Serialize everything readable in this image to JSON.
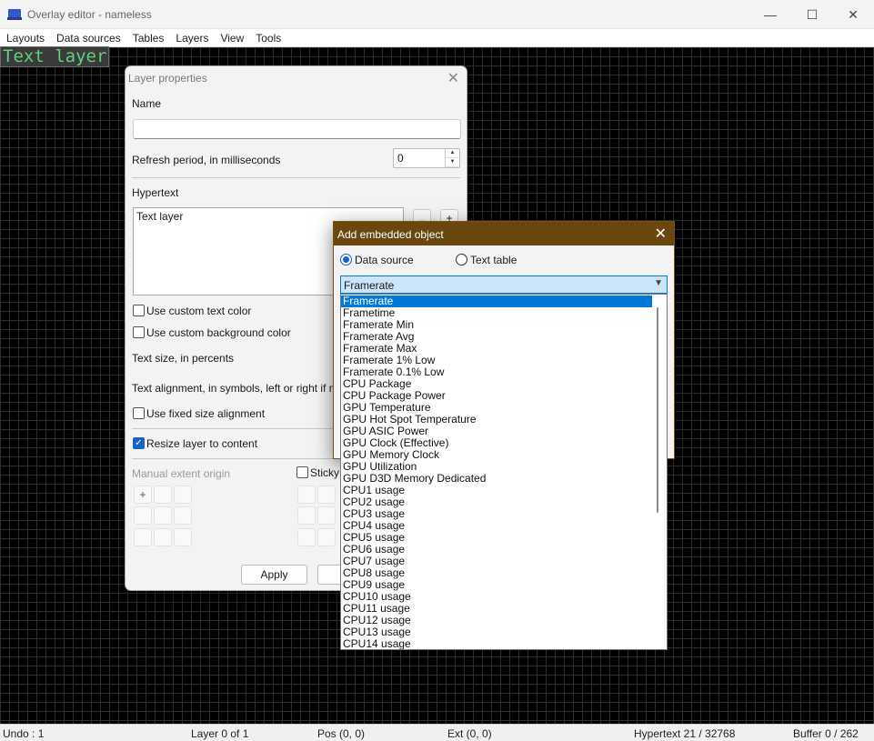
{
  "window": {
    "title": "Overlay editor - nameless",
    "minimize": "—",
    "maximize": "☐",
    "close": "✕"
  },
  "menu": [
    "Layouts",
    "Data sources",
    "Tables",
    "Layers",
    "View",
    "Tools"
  ],
  "canvas": {
    "layer_label": "Text layer"
  },
  "status": {
    "undo": "Undo : 1",
    "layer": "Layer 0 of 1",
    "pos": "Pos (0, 0)",
    "ext": "Ext (0, 0)",
    "hypertext": "Hypertext 21 / 32768",
    "buffer": "Buffer 0 / 262"
  },
  "layer_props": {
    "title": "Layer properties",
    "name_label": "Name",
    "name_value": "",
    "refresh_label": "Refresh period, in milliseconds",
    "refresh_value": "0",
    "hypertext_label": "Hypertext",
    "hypertext_value": "Text layer",
    "more_btn": "...",
    "add_btn": "+",
    "custom_text_color": "Use custom text color",
    "custom_bg_color": "Use custom background color",
    "text_size": "Text size, in percents",
    "text_alignment": "Text alignment, in symbols, left or right if nega",
    "fixed_alignment": "Use fixed size alignment",
    "resize_layer": "Resize layer to content",
    "manual_extent": "Manual extent origin",
    "sticky": "Sticky l",
    "grid_plus": "+",
    "apply": "Apply"
  },
  "embed": {
    "title": "Add embedded object",
    "data_source": "Data source",
    "text_table": "Text table",
    "selected": "Framerate",
    "options": [
      "Framerate",
      "Frametime",
      "Framerate Min",
      "Framerate Avg",
      "Framerate Max",
      "Framerate 1% Low",
      "Framerate 0.1% Low",
      "CPU Package",
      "CPU Package Power",
      "GPU Temperature",
      "GPU Hot Spot Temperature",
      "GPU ASIC Power",
      "GPU Clock (Effective)",
      "GPU Memory Clock",
      "GPU Utilization",
      "GPU D3D Memory Dedicated",
      "CPU1 usage",
      "CPU2 usage",
      "CPU3 usage",
      "CPU4 usage",
      "CPU5 usage",
      "CPU6 usage",
      "CPU7 usage",
      "CPU8 usage",
      "CPU9 usage",
      "CPU10 usage",
      "CPU11 usage",
      "CPU12 usage",
      "CPU13 usage",
      "CPU14 usage"
    ]
  }
}
